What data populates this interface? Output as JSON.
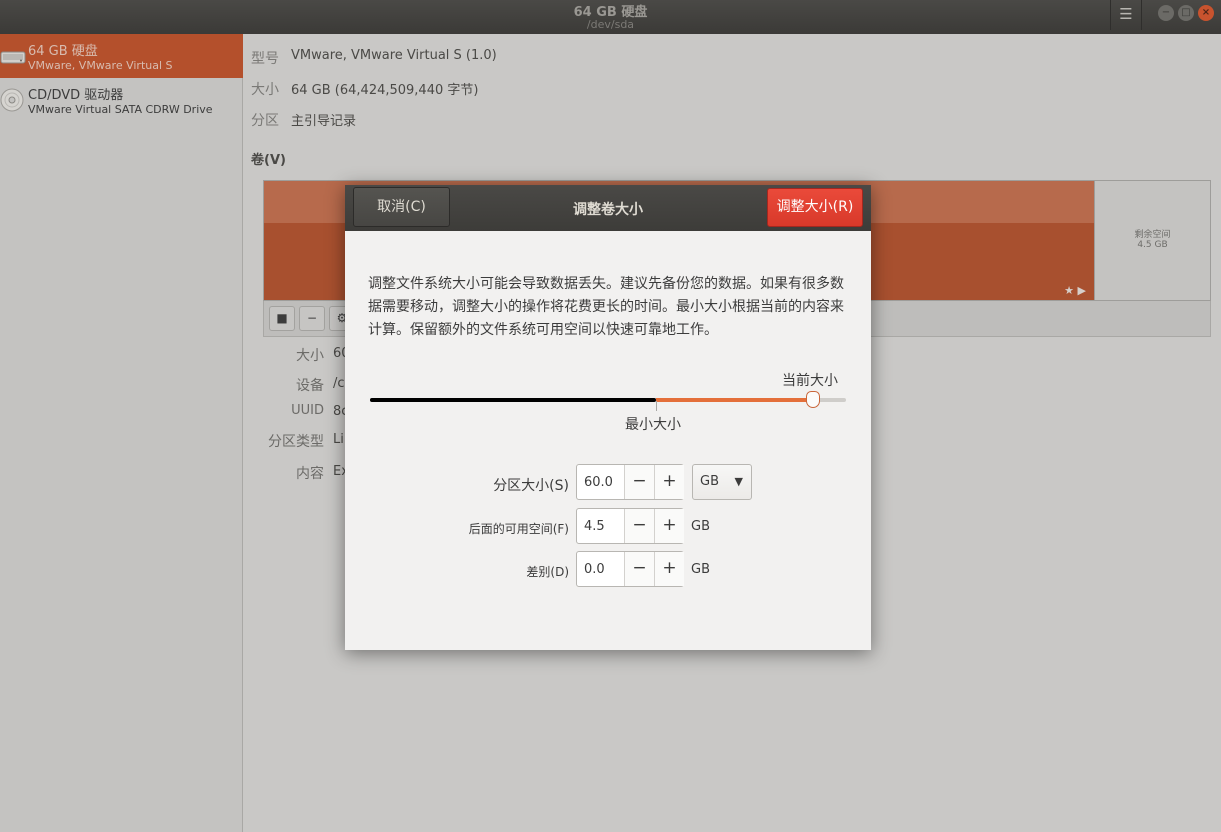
{
  "window": {
    "title": "64 GB 硬盘",
    "subtitle": "/dev/sda",
    "menu_icon": "☰",
    "minimize_icon": "−",
    "maximize_icon": "□",
    "close_icon": "×"
  },
  "sidebar": {
    "devices": [
      {
        "name": "64 GB 硬盘",
        "sub": "VMware, VMware Virtual S",
        "icon": "hard-disk-icon",
        "selected": true
      },
      {
        "name": "CD/DVD 驱动器",
        "sub": "VMware Virtual SATA CDRW Drive",
        "icon": "optical-drive-icon",
        "selected": false
      }
    ]
  },
  "disk_info": {
    "model_label": "型号",
    "model_value": "VMware, VMware Virtual S (1.0)",
    "size_label": "大小",
    "size_value": "64 GB (64,424,509,440 字节)",
    "partition_label": "分区",
    "partition_value": "主引导记录"
  },
  "volumes": {
    "title": "卷(V)",
    "free_label": "剩余空间",
    "free_size": "4.5 GB",
    "star_icon": "★ ▶",
    "tools": [
      "■",
      "−",
      "⚙"
    ]
  },
  "details": {
    "rows": [
      {
        "label": "大小",
        "value": "60"
      },
      {
        "label": "设备",
        "value": "/c"
      },
      {
        "label": "UUID",
        "value": "8c"
      },
      {
        "label": "分区类型",
        "value": "Li"
      },
      {
        "label": "内容",
        "value": "Ex"
      }
    ]
  },
  "dialog": {
    "title": "调整卷大小",
    "cancel_label": "取消(C)",
    "resize_label": "调整大小(R)",
    "warning": "调整文件系统大小可能会导致数据丢失。建议先备份您的数据。如果有很多数据需要移动，调整大小的操作将花费更长的时间。最小大小根据当前的内容来计算。保留额外的文件系统可用空间以快速可靠地工作。",
    "current_size_label": "当前大小",
    "min_size_label": "最小大小",
    "slider": {
      "min_fraction": 0.6,
      "value_fraction": 0.93
    },
    "partition_size_label": "分区大小(S)",
    "partition_size_value": "60.0",
    "unit_value": "GB",
    "free_after_label": "后面的可用空间(F)",
    "free_after_value": "4.5",
    "free_after_unit": "GB",
    "difference_label": "差别(D)",
    "difference_value": "0.0",
    "difference_unit": "GB",
    "minus": "−",
    "plus": "+",
    "dropdown_arrow": "▼"
  }
}
